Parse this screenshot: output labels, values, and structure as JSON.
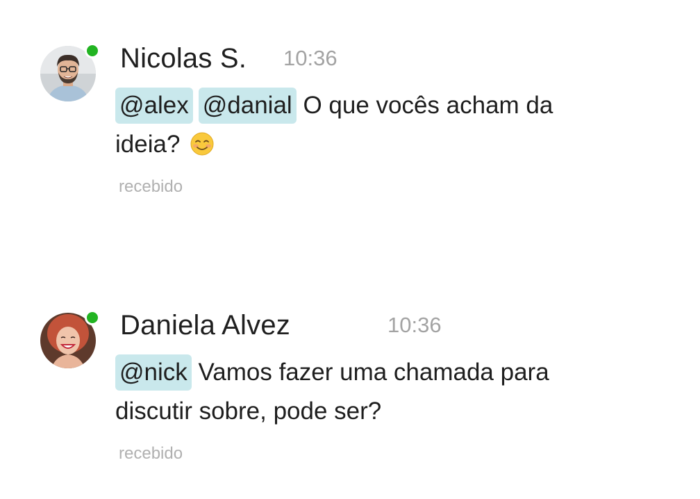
{
  "messages": [
    {
      "author": "Nicolas S.",
      "time": "10:36",
      "mentions": [
        "@alex",
        "@danial"
      ],
      "text_line1": "O que vocês acham da",
      "text_line2": "ideia?",
      "emoji": "smiling-face-icon",
      "status": "recebido",
      "online": true
    },
    {
      "author": "Daniela Alvez",
      "time": "10:36",
      "mentions": [
        "@nick"
      ],
      "text_line1": "Vamos fazer uma chamada para",
      "text_line2": "discutir sobre, pode ser?",
      "status": "recebido",
      "online": true
    }
  ],
  "colors": {
    "presence": "#22b422",
    "mention_bg": "#c9e8ec",
    "time": "#a3a3a3",
    "status": "#b0b0b0"
  }
}
